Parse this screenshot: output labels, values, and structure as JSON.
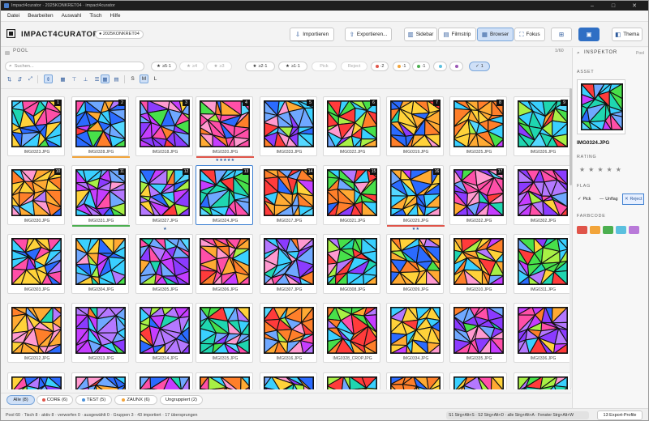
{
  "window": {
    "title": "Impact4curator · 2025KONKRET04 · impact4curator",
    "controls": [
      "–",
      "□",
      "✕"
    ]
  },
  "menu": [
    "Datei",
    "Bearbeiten",
    "Auswahl",
    "Tisch",
    "Hilfe"
  ],
  "header": {
    "app_name": "IMPACT4CURATOR",
    "project_badge": "2025KONKRET04",
    "import_label": "Importieren",
    "export_label": "Exportieren...",
    "view_modes": [
      "Sidebar",
      "Filmstrip",
      "Browser",
      "Fokus"
    ],
    "active_view": "Browser",
    "theme_label": "Thema"
  },
  "pool": {
    "label": "POOL",
    "count": "1/60"
  },
  "filters": {
    "search_placeholder": "Suchen...",
    "pills": [
      {
        "label": "≥5·1",
        "icon": "★"
      },
      {
        "label": "≥4",
        "icon": "★",
        "muted": true
      },
      {
        "label": "≥3",
        "icon": "★",
        "muted": true
      },
      {
        "label": "≥2·1",
        "icon": "★"
      },
      {
        "label": "≥1·1",
        "icon": "★"
      },
      {
        "label": "Pick",
        "muted": true
      },
      {
        "label": "Reject",
        "muted": true
      },
      {
        "label": "·2",
        "dot": "#e0554a"
      },
      {
        "label": "·1",
        "dot": "#f2a43a"
      },
      {
        "label": "·1",
        "dot": "#4caf50"
      },
      {
        "label": "",
        "dot": "#5bc0de"
      },
      {
        "label": "",
        "dot": "#9b59b6"
      },
      {
        "label": "1",
        "icon": "✓",
        "active": true
      }
    ]
  },
  "viewbar": {
    "sizes": [
      "S",
      "M",
      "L"
    ],
    "active_size": "M"
  },
  "assets": [
    {
      "name": "IMG0323.JPG",
      "num": "1"
    },
    {
      "name": "IMG0328.JPG",
      "num": "2",
      "label_color": "#f2a43a"
    },
    {
      "name": "IMG0318.JPG",
      "num": "3"
    },
    {
      "name": "IMG0320.JPG",
      "num": "4",
      "label_color": "#e0554a",
      "stars": "★★★★★"
    },
    {
      "name": "IMG0333.JPG",
      "num": "5"
    },
    {
      "name": "IMG0322.JPG",
      "num": "6"
    },
    {
      "name": "IMG0319.JPG",
      "num": "7"
    },
    {
      "name": "IMG0325.JPG",
      "num": "8"
    },
    {
      "name": "IMG0326.JPG",
      "num": "9"
    },
    {
      "name": "IMG0330.JPG",
      "num": "10"
    },
    {
      "name": "IMG0331.JPG",
      "num": "11",
      "label_color": "#4caf50"
    },
    {
      "name": "IMG0327.JPG",
      "num": "12",
      "stars": "★"
    },
    {
      "name": "IMG0324.JPG",
      "num": "13",
      "selected": true
    },
    {
      "name": "IMG0317.JPG",
      "num": "14"
    },
    {
      "name": "IMG0321.JPG",
      "num": "15"
    },
    {
      "name": "IMG0329.JPG",
      "num": "16",
      "label_color": "#e0554a",
      "stars": "★★"
    },
    {
      "name": "IMG0332.JPG",
      "num": "17"
    },
    {
      "name": "IMG0302.JPG",
      "num": ""
    },
    {
      "name": "IMG0303.JPG",
      "num": ""
    },
    {
      "name": "IMG0304.JPG",
      "num": ""
    },
    {
      "name": "IMG0305.JPG",
      "num": ""
    },
    {
      "name": "IMG0306.JPG",
      "num": ""
    },
    {
      "name": "IMG0307.JPG",
      "num": ""
    },
    {
      "name": "IMG0308.JPG",
      "num": ""
    },
    {
      "name": "IMG0309.JPG",
      "num": ""
    },
    {
      "name": "IMG0310.JPG",
      "num": ""
    },
    {
      "name": "IMG0311.JPG",
      "num": ""
    },
    {
      "name": "IMG0312.JPG",
      "num": ""
    },
    {
      "name": "IMG0313.JPG",
      "num": ""
    },
    {
      "name": "IMG0314.JPG",
      "num": ""
    },
    {
      "name": "IMG0315.JPG",
      "num": ""
    },
    {
      "name": "IMG0316.JPG",
      "num": ""
    },
    {
      "name": "IMG0328_CROP.JPG",
      "num": ""
    },
    {
      "name": "IMG0334.JPG",
      "num": ""
    },
    {
      "name": "IMG0335.JPG",
      "num": ""
    },
    {
      "name": "IMG0336.JPG",
      "num": ""
    },
    {
      "name": "",
      "num": ""
    },
    {
      "name": "",
      "num": ""
    },
    {
      "name": "",
      "num": ""
    },
    {
      "name": "",
      "num": ""
    },
    {
      "name": "",
      "num": ""
    },
    {
      "name": "",
      "num": ""
    },
    {
      "name": "",
      "num": ""
    },
    {
      "name": "",
      "num": ""
    },
    {
      "name": "",
      "num": ""
    }
  ],
  "groups": [
    {
      "label": "Alle (8)",
      "active": true
    },
    {
      "label": "CORE (6)",
      "dot": "#e0554a"
    },
    {
      "label": "TEST (5)",
      "dot": "#4a90d9"
    },
    {
      "label": "ZAUNX (6)",
      "dot": "#f2a43a"
    },
    {
      "label": "Ungruppiert (2)"
    }
  ],
  "status": {
    "text": "Pool 60 · Tisch 8 · aktiv 8 · verworfen 0 · ausgewählt 0 · Gruppen 3 · 43 importiert · 17 übersprungen",
    "shortcuts": "S1 Strg+Alt+S · S2 Strg+Alt+D · alle Strg+Alt+A · Fenster Strg+Alt+W",
    "export_profiles": "13 Export-Profile"
  },
  "inspector": {
    "title": "INSPEKTOR",
    "pool_label": "Pool",
    "asset_heading": "ASSET",
    "asset_name": "IMG0324.JPG",
    "rating_heading": "RATING",
    "rating_stars": "★★★★★",
    "flag_heading": "FLAG",
    "flags": [
      "Pick",
      "Unflag",
      "Reject"
    ],
    "active_flag": "Reject",
    "color_heading": "FARBCODE",
    "colors": [
      "#e0554a",
      "#f2a43a",
      "#4caf50",
      "#5bc0de",
      "#b97ad9"
    ]
  },
  "colors": {
    "accent": "#3d7fd1",
    "accent_light": "#cfe0f7"
  }
}
